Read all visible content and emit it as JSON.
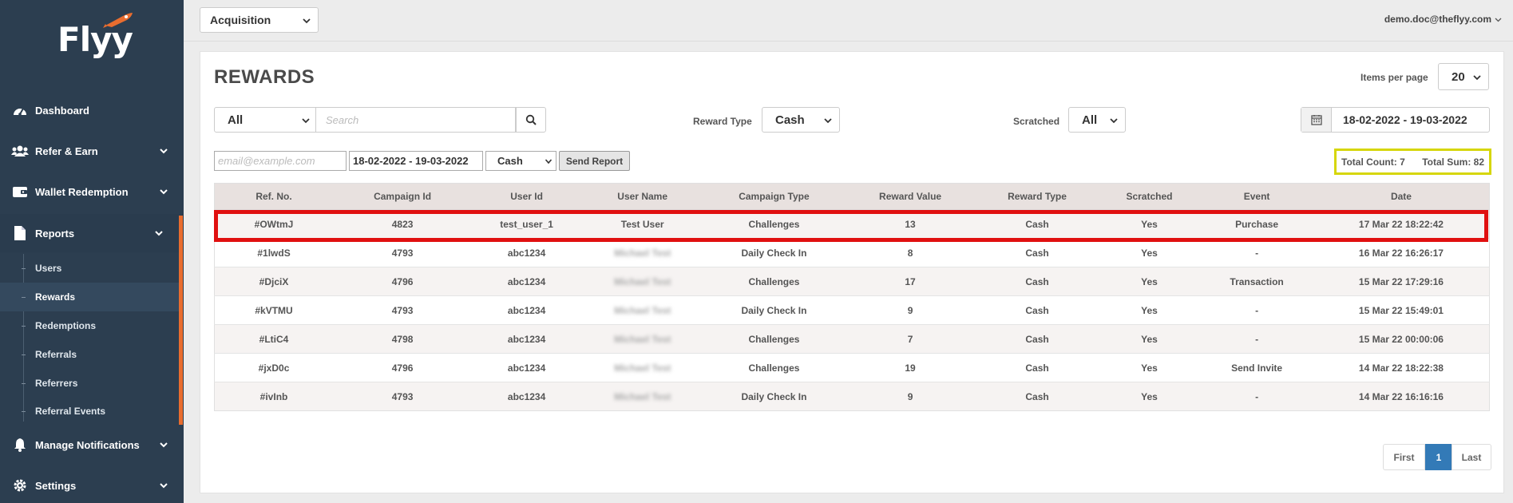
{
  "app": {
    "brand": "Flyy",
    "user_email": "demo.doc@theflyy.com"
  },
  "topbar": {
    "app_selector": "Acquisition"
  },
  "sidebar": {
    "items": [
      {
        "label": "Dashboard",
        "icon": "dashboard-icon"
      },
      {
        "label": "Refer & Earn",
        "icon": "users-icon"
      },
      {
        "label": "Wallet Redemption",
        "icon": "wallet-icon"
      },
      {
        "label": "Reports",
        "icon": "document-icon"
      },
      {
        "label": "Manage Notifications",
        "icon": "bell-icon"
      },
      {
        "label": "Settings",
        "icon": "gear-icon"
      }
    ],
    "report_subitems": [
      "Users",
      "Rewards",
      "Redemptions",
      "Referrals",
      "Referrers",
      "Referral Events"
    ],
    "active_subitem": "Rewards"
  },
  "page": {
    "title": "REWARDS",
    "items_per_page_label": "Items per page",
    "items_per_page": "20"
  },
  "filters": {
    "field_select": "All",
    "search_placeholder": "Search",
    "reward_type_label": "Reward Type",
    "reward_type": "Cash",
    "scratched_label": "Scratched",
    "scratched": "All",
    "date_range": "18-02-2022 - 19-03-2022"
  },
  "report": {
    "email_placeholder": "email@example.com",
    "date_range": "18-02-2022 - 19-03-2022",
    "type": "Cash",
    "send_label": "Send Report"
  },
  "totals": {
    "count_label": "Total Count: 7",
    "sum_label": "Total Sum: 82"
  },
  "table": {
    "headers": [
      "Ref. No.",
      "Campaign Id",
      "User Id",
      "User Name",
      "Campaign Type",
      "Reward Value",
      "Reward Type",
      "Scratched",
      "Event",
      "Date"
    ],
    "rows": [
      [
        "#OWtmJ",
        "4823",
        "test_user_1",
        "Test User",
        "Challenges",
        "13",
        "Cash",
        "Yes",
        "Purchase",
        "17 Mar 22 18:22:42"
      ],
      [
        "#1lwdS",
        "4793",
        "abc1234",
        "Michael Test",
        "Daily Check In",
        "8",
        "Cash",
        "Yes",
        "-",
        "16 Mar 22 16:26:17"
      ],
      [
        "#DjciX",
        "4796",
        "abc1234",
        "Michael Test",
        "Challenges",
        "17",
        "Cash",
        "Yes",
        "Transaction",
        "15 Mar 22 17:29:16"
      ],
      [
        "#kVTMU",
        "4793",
        "abc1234",
        "Michael Test",
        "Daily Check In",
        "9",
        "Cash",
        "Yes",
        "-",
        "15 Mar 22 15:49:01"
      ],
      [
        "#LtiC4",
        "4798",
        "abc1234",
        "Michael Test",
        "Challenges",
        "7",
        "Cash",
        "Yes",
        "-",
        "15 Mar 22 00:00:06"
      ],
      [
        "#jxD0c",
        "4796",
        "abc1234",
        "Michael Test",
        "Challenges",
        "19",
        "Cash",
        "Yes",
        "Send Invite",
        "14 Mar 22 18:22:38"
      ],
      [
        "#ivInb",
        "4793",
        "abc1234",
        "Michael Test",
        "Daily Check In",
        "9",
        "Cash",
        "Yes",
        "-",
        "14 Mar 22 16:16:16"
      ]
    ]
  },
  "pagination": {
    "first": "First",
    "current": "1",
    "last": "Last"
  },
  "colors": {
    "sidebar_bg": "#2c3e50",
    "accent_orange": "#e96d2f",
    "highlight_red": "#e01010",
    "highlight_yellow": "#d6d60a",
    "pager_active": "#337ab7"
  }
}
